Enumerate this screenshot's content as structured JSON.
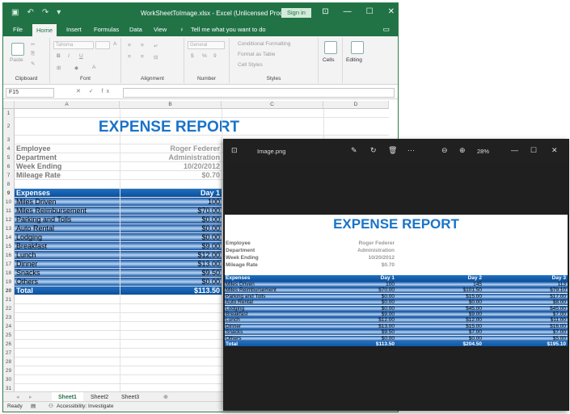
{
  "excel": {
    "title": "WorkSheetToImage.xlsx  -  Excel (Unlicensed Product)",
    "signin_label": "Sign in",
    "tabs": [
      "File",
      "Home",
      "Insert",
      "Formulas",
      "Data",
      "View"
    ],
    "active_tab": "Home",
    "tell_me": "Tell me what you want to do",
    "ribbon": {
      "clipboard": "Clipboard",
      "paste": "Paste",
      "font_name": "Tahoma",
      "font": "Font",
      "alignment": "Alignment",
      "number_format": "General",
      "number": "Number",
      "conditional_formatting": "Conditional Formatting",
      "format_as_table": "Format as Table",
      "cell_styles": "Cell Styles",
      "styles": "Styles",
      "cells": "Cells",
      "editing": "Editing"
    },
    "name_box": "F15",
    "fx_label": "fx",
    "columns": [
      "A",
      "B",
      "C",
      "D"
    ],
    "sheet_tabs": [
      "Sheet1",
      "Sheet2",
      "Sheet3"
    ],
    "active_sheet": "Sheet1",
    "status": "Ready",
    "accessibility": "Accessibility: Investigate"
  },
  "report": {
    "title": "EXPENSE REPORT",
    "info": [
      {
        "label": "Employee",
        "value": "Roger Federer"
      },
      {
        "label": "Department",
        "value": "Administration"
      },
      {
        "label": "Week Ending",
        "value": "10/20/2012"
      },
      {
        "label": "Mileage Rate",
        "value": "$0.70"
      }
    ],
    "header": [
      "Expenses",
      "Day 1",
      "Day 2",
      "Day 3"
    ],
    "rows": [
      [
        "Miles Driven",
        "100",
        "145",
        "113"
      ],
      [
        "Miles Reimbursement",
        "$70.00",
        "$101.50",
        "$79.10"
      ],
      [
        "Parking and Tolls",
        "$0.00",
        "$15.00",
        "$17.00"
      ],
      [
        "Auto Rental",
        "$0.00",
        "$0.00",
        "$8.00"
      ],
      [
        "Lodging",
        "$0.00",
        "$45.00",
        "$45.00"
      ],
      [
        "Breakfast",
        "$9.00",
        "$9.00",
        "$7.00"
      ],
      [
        "Lunch",
        "$12.00",
        "$12.00",
        "$11.00"
      ],
      [
        "Dinner",
        "$13.00",
        "$15.00",
        "$16.00"
      ],
      [
        "Snacks",
        "$9.50",
        "$7.00",
        "$7.00"
      ],
      [
        "Others",
        "$0.00",
        "$0.00",
        "$5.00"
      ]
    ],
    "total": [
      "Total",
      "$113.50",
      "$204.50",
      "$195.10"
    ]
  },
  "viewer": {
    "filename": "Image.png",
    "zoom": "28%"
  }
}
